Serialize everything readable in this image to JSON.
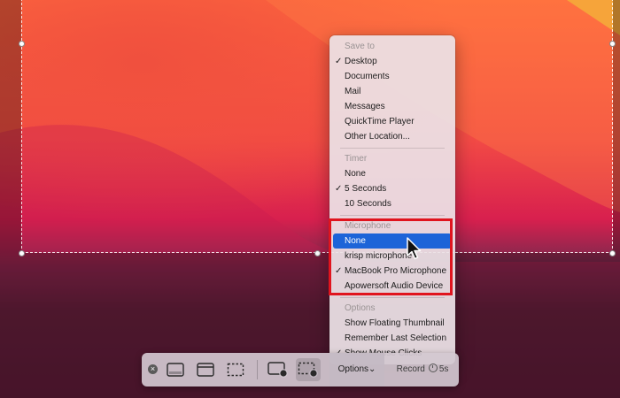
{
  "menu": {
    "sections": [
      {
        "header": "Save to",
        "items": [
          {
            "label": "Desktop",
            "checked": true
          },
          {
            "label": "Documents",
            "checked": false
          },
          {
            "label": "Mail",
            "checked": false
          },
          {
            "label": "Messages",
            "checked": false
          },
          {
            "label": "QuickTime Player",
            "checked": false
          },
          {
            "label": "Other Location...",
            "checked": false
          }
        ]
      },
      {
        "header": "Timer",
        "items": [
          {
            "label": "None",
            "checked": false
          },
          {
            "label": "5 Seconds",
            "checked": true
          },
          {
            "label": "10 Seconds",
            "checked": false
          }
        ]
      },
      {
        "header": "Microphone",
        "items": [
          {
            "label": "None",
            "checked": false,
            "selected": true
          },
          {
            "label": "krisp microphone",
            "checked": false
          },
          {
            "label": "MacBook Pro Microphone",
            "checked": true
          },
          {
            "label": "Apowersoft Audio Device",
            "checked": false
          }
        ]
      },
      {
        "header": "Options",
        "items": [
          {
            "label": "Show Floating Thumbnail",
            "checked": false
          },
          {
            "label": "Remember Last Selection",
            "checked": false
          },
          {
            "label": "Show Mouse Clicks",
            "checked": true
          }
        ]
      }
    ],
    "check_glyph": "✓"
  },
  "toolbar": {
    "close_icon": "×",
    "buttons": [
      {
        "icon": "capture-entire-screen-icon"
      },
      {
        "icon": "capture-selected-window-icon"
      },
      {
        "icon": "capture-selected-portion-icon"
      },
      {
        "icon": "record-entire-screen-icon"
      },
      {
        "icon": "record-selected-portion-icon",
        "active": true
      }
    ],
    "options_label": "Options⌄",
    "record_label": "Record",
    "record_timer": "5s"
  },
  "colors": {
    "selection_highlight": "#1d64d8",
    "annotation_box": "#e0141e"
  }
}
